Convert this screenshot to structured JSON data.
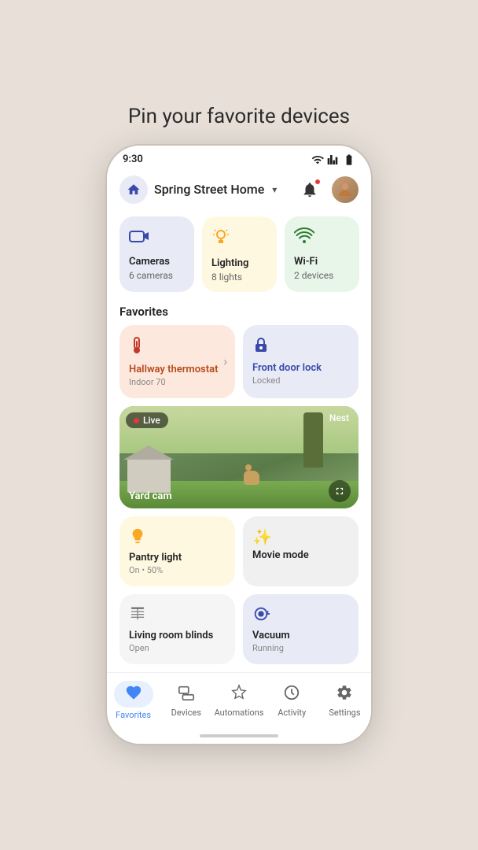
{
  "page": {
    "title": "Pin your favorite devices"
  },
  "status_bar": {
    "time": "9:30"
  },
  "header": {
    "home_name": "Spring Street Home",
    "bell_label": "Notifications",
    "avatar_label": "User avatar"
  },
  "device_cards": [
    {
      "id": "cameras",
      "icon": "📷",
      "name": "Cameras",
      "count": "6 cameras",
      "type": "cameras"
    },
    {
      "id": "lighting",
      "icon": "💡",
      "name": "Lighting",
      "count": "8 lights",
      "type": "lighting"
    },
    {
      "id": "wifi",
      "icon": "📶",
      "name": "Wi-Fi",
      "count": "2 devices",
      "type": "wifi"
    }
  ],
  "favorites_section": {
    "label": "Favorites",
    "items": [
      {
        "id": "thermostat",
        "name": "Hallway thermostat",
        "status": "Indoor 70",
        "type": "thermostat"
      },
      {
        "id": "doorlock",
        "name": "Front door lock",
        "status": "Locked",
        "type": "doorlock"
      }
    ]
  },
  "camera_feed": {
    "label": "Yard cam",
    "badge": "Live",
    "brand": "Nest"
  },
  "action_cards": [
    {
      "id": "pantry",
      "icon": "💡",
      "name": "Pantry light",
      "status": "On • 50%",
      "type": "pantry"
    },
    {
      "id": "movie",
      "icon": "✨",
      "name": "Movie mode",
      "status": "",
      "type": "movie"
    }
  ],
  "action_cards2": [
    {
      "id": "blinds",
      "icon": "🪟",
      "name": "Living room blinds",
      "status": "Open",
      "type": "blinds"
    },
    {
      "id": "vacuum",
      "icon": "🤖",
      "name": "Vacuum",
      "status": "Running",
      "type": "vacuum"
    }
  ],
  "bottom_nav": [
    {
      "id": "favorites",
      "icon": "♥",
      "label": "Favorites",
      "active": true
    },
    {
      "id": "devices",
      "icon": "📱",
      "label": "Devices",
      "active": false
    },
    {
      "id": "automations",
      "icon": "✨",
      "label": "Automations",
      "active": false
    },
    {
      "id": "activity",
      "icon": "🕐",
      "label": "Activity",
      "active": false
    },
    {
      "id": "settings",
      "icon": "⚙",
      "label": "Settings",
      "active": false
    }
  ]
}
